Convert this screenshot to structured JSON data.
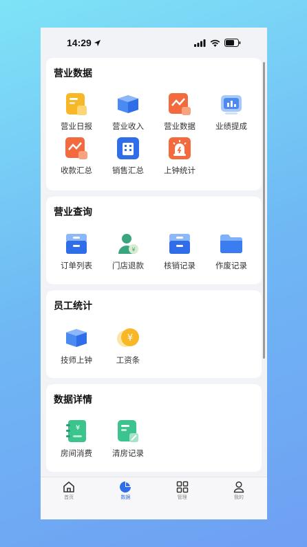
{
  "status": {
    "time": "14:29"
  },
  "sections": [
    {
      "title": "营业数据",
      "items": [
        {
          "label": "营业日报",
          "icon": "daily-report-icon"
        },
        {
          "label": "营业收入",
          "icon": "revenue-box-icon"
        },
        {
          "label": "营业数据",
          "icon": "business-data-icon"
        },
        {
          "label": "业绩提成",
          "icon": "commission-chart-icon"
        },
        {
          "label": "收款汇总",
          "icon": "payment-summary-icon"
        },
        {
          "label": "销售汇总",
          "icon": "sales-building-icon"
        },
        {
          "label": "上钟统计",
          "icon": "alarm-bell-icon"
        }
      ]
    },
    {
      "title": "营业查询",
      "items": [
        {
          "label": "订单列表",
          "icon": "order-cabinet-icon"
        },
        {
          "label": "门店退款",
          "icon": "refund-person-icon"
        },
        {
          "label": "核销记录",
          "icon": "writeoff-cabinet-icon"
        },
        {
          "label": "作废记录",
          "icon": "folder-icon"
        }
      ]
    },
    {
      "title": "员工统计",
      "items": [
        {
          "label": "技师上钟",
          "icon": "technician-box-icon"
        },
        {
          "label": "工资条",
          "icon": "coin-yen-icon"
        }
      ]
    },
    {
      "title": "数据详情",
      "items": [
        {
          "label": "房间消费",
          "icon": "room-notebook-icon"
        },
        {
          "label": "清房记录",
          "icon": "room-clean-icon"
        }
      ]
    }
  ],
  "tabbar": [
    {
      "label": "首页",
      "icon": "home-icon"
    },
    {
      "label": "数据",
      "icon": "pie-chart-icon",
      "active": true
    },
    {
      "label": "管理",
      "icon": "grid-icon"
    },
    {
      "label": "我的",
      "icon": "person-icon"
    }
  ],
  "colors": {
    "accent": "#2f6ee8",
    "orange": "#f26a3d",
    "yellow": "#f7b727",
    "green": "#3cc48f"
  }
}
